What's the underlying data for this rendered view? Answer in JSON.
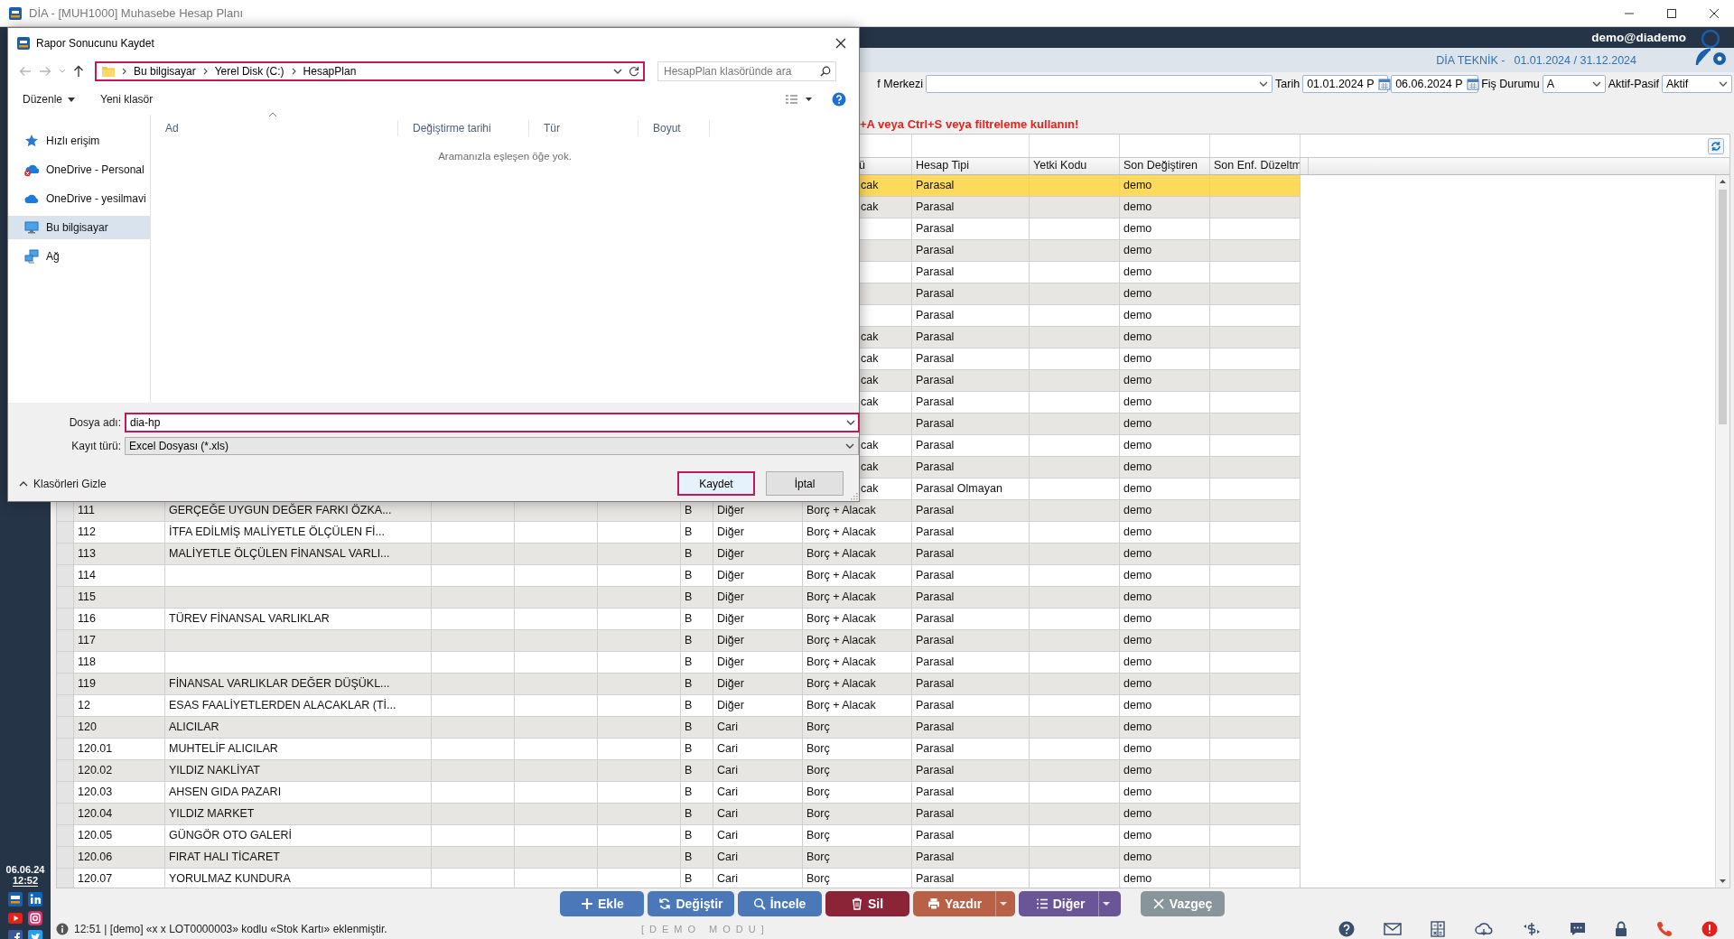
{
  "window": {
    "title": "DİA - [MUH1000] Muhasebe Hesap Planı"
  },
  "sidebar": {
    "date": "06.06.24",
    "time": "12:52"
  },
  "header": {
    "user": "demo@diademo",
    "company": "DİA TEKNİK -",
    "period": "01.01.2024 / 31.12.2024"
  },
  "filters": {
    "cost_center_label": "f Merkezi",
    "date_label": "Tarih",
    "date_from": "01.01.2024 P",
    "date_to": "06.06.2024 P",
    "status_label": "Fiş Durumu",
    "status": "A",
    "active_label": "Aktif-Pasif",
    "active": "Aktif"
  },
  "hint": "+A veya Ctrl+S veya filtreleme kullanın!",
  "table": {
    "columns": [
      "ü",
      "Hesap Tipi",
      "Yetki Kodu",
      "Son Değiştiren",
      "Son Enf. Düzeltm"
    ],
    "rows": [
      {
        "selected": true,
        "balance": "cak",
        "type": "Parasal",
        "modified_by": "demo"
      },
      {
        "selected": false,
        "balance": "cak",
        "type": "Parasal",
        "modified_by": "demo"
      },
      {
        "selected": false,
        "type": "Parasal",
        "modified_by": "demo"
      },
      {
        "selected": false,
        "type": "Parasal",
        "modified_by": "demo"
      },
      {
        "selected": false,
        "type": "Parasal",
        "modified_by": "demo"
      },
      {
        "selected": false,
        "type": "Parasal",
        "modified_by": "demo"
      },
      {
        "selected": false,
        "type": "Parasal",
        "modified_by": "demo"
      },
      {
        "selected": false,
        "balance": "cak",
        "type": "Parasal",
        "modified_by": "demo"
      },
      {
        "selected": false,
        "balance": "cak",
        "type": "Parasal",
        "modified_by": "demo"
      },
      {
        "selected": false,
        "balance": "cak",
        "type": "Parasal",
        "modified_by": "demo"
      },
      {
        "selected": false,
        "balance": "cak",
        "type": "Parasal",
        "modified_by": "demo"
      },
      {
        "selected": false,
        "type": "Parasal",
        "modified_by": "demo"
      },
      {
        "selected": false,
        "balance": "cak",
        "type": "Parasal",
        "modified_by": "demo"
      },
      {
        "selected": false,
        "balance": "cak",
        "type": "Parasal",
        "modified_by": "demo"
      },
      {
        "selected": false,
        "balance": "cak",
        "type": "Parasal Olmayan",
        "modified_by": "demo"
      },
      {
        "selected": false,
        "code": "111",
        "name": "GERÇEĞE UYGUN DEĞER FARKI ÖZKA...",
        "column_6": "B",
        "group": "Diğer",
        "balance": "Borç + Alacak",
        "type": "Parasal",
        "modified_by": "demo"
      },
      {
        "selected": false,
        "code": "112",
        "name": "İTFA EDİLMİŞ MALİYETLE ÖLÇÜLEN Fİ...",
        "column_6": "B",
        "group": "Diğer",
        "balance": "Borç + Alacak",
        "type": "Parasal",
        "modified_by": "demo"
      },
      {
        "selected": false,
        "code": "113",
        "name": "MALİYETLE ÖLÇÜLEN FİNANSAL VARLI...",
        "column_6": "B",
        "group": "Diğer",
        "balance": "Borç + Alacak",
        "type": "Parasal",
        "modified_by": "demo"
      },
      {
        "selected": false,
        "code": "114",
        "column_6": "B",
        "group": "Diğer",
        "balance": "Borç + Alacak",
        "type": "Parasal",
        "modified_by": "demo"
      },
      {
        "selected": false,
        "code": "115",
        "column_6": "B",
        "group": "Diğer",
        "balance": "Borç + Alacak",
        "type": "Parasal",
        "modified_by": "demo"
      },
      {
        "selected": false,
        "code": "116",
        "name": "TÜREV FİNANSAL VARLIKLAR",
        "column_6": "B",
        "group": "Diğer",
        "balance": "Borç + Alacak",
        "type": "Parasal",
        "modified_by": "demo"
      },
      {
        "selected": false,
        "code": "117",
        "column_6": "B",
        "group": "Diğer",
        "balance": "Borç + Alacak",
        "type": "Parasal",
        "modified_by": "demo"
      },
      {
        "selected": false,
        "code": "118",
        "column_6": "B",
        "group": "Diğer",
        "balance": "Borç + Alacak",
        "type": "Parasal",
        "modified_by": "demo"
      },
      {
        "selected": false,
        "code": "119",
        "name": "FİNANSAL VARLIKLAR DEĞER DÜŞÜKL...",
        "column_6": "B",
        "group": "Diğer",
        "balance": "Borç + Alacak",
        "type": "Parasal",
        "modified_by": "demo"
      },
      {
        "selected": false,
        "code": "12",
        "name": "ESAS FAALİYETLERDEN ALACAKLAR (Tİ...",
        "column_6": "B",
        "group": "Diğer",
        "balance": "Borç + Alacak",
        "type": "Parasal",
        "modified_by": "demo"
      },
      {
        "selected": false,
        "code": "120",
        "name": "ALICILAR",
        "column_6": "B",
        "group": "Cari",
        "balance": "Borç",
        "type": "Parasal",
        "modified_by": "demo"
      },
      {
        "selected": false,
        "code": "120.01",
        "name": "MUHTELİF ALICILAR",
        "column_6": "B",
        "group": "Cari",
        "balance": "Borç",
        "type": "Parasal",
        "modified_by": "demo"
      },
      {
        "selected": false,
        "code": "120.02",
        "name": "YILDIZ NAKLİYAT",
        "column_6": "B",
        "group": "Cari",
        "balance": "Borç",
        "type": "Parasal",
        "modified_by": "demo"
      },
      {
        "selected": false,
        "code": "120.03",
        "name": "AHSEN GIDA PAZARI",
        "column_6": "B",
        "group": "Cari",
        "balance": "Borç",
        "type": "Parasal",
        "modified_by": "demo"
      },
      {
        "selected": false,
        "code": "120.04",
        "name": "YILDIZ MARKET",
        "column_6": "B",
        "group": "Cari",
        "balance": "Borç",
        "type": "Parasal",
        "modified_by": "demo"
      },
      {
        "selected": false,
        "code": "120.05",
        "name": "GÜNGÖR OTO GALERİ",
        "column_6": "B",
        "group": "Cari",
        "balance": "Borç",
        "type": "Parasal",
        "modified_by": "demo"
      },
      {
        "selected": false,
        "code": "120.06",
        "name": "FIRAT HALI TİCARET",
        "column_6": "B",
        "group": "Cari",
        "balance": "Borç",
        "type": "Parasal",
        "modified_by": "demo"
      },
      {
        "selected": false,
        "code": "120.07",
        "name": "YORULMAZ KUNDURA",
        "column_6": "B",
        "group": "Cari",
        "balance": "Borç",
        "type": "Parasal",
        "modified_by": "demo"
      }
    ]
  },
  "buttons": [
    {
      "label": "Ekle",
      "kind": "add",
      "color": "#4a78b9",
      "dropdown": false
    },
    {
      "label": "Değiştir",
      "kind": "edit",
      "color": "#4a78b9",
      "dropdown": false
    },
    {
      "label": "İncele",
      "kind": "inspect",
      "color": "#4a78b9",
      "dropdown": false
    },
    {
      "label": "Sil",
      "kind": "delete",
      "color": "#8c2438",
      "dropdown": false
    },
    {
      "label": "Yazdır",
      "kind": "print",
      "color": "#b96147",
      "dropdown": true
    },
    {
      "label": "Diğer",
      "kind": "more",
      "color": "#6a5697",
      "dropdown": true
    },
    {
      "label": "Vazgeç",
      "kind": "cancel",
      "color": "#88969b",
      "dropdown": false
    }
  ],
  "status_bar": {
    "message": "12:51 | [demo] «x x LOT0000003» kodlu «Stok Kartı» eklenmiştir.",
    "mode": "[DEMO MODU]"
  },
  "dialog": {
    "title": "Rapor Sonucunu Kaydet",
    "path": [
      "Bu bilgisayar",
      "Yerel Disk (C:)",
      "HesapPlan"
    ],
    "path_highlighted": true,
    "search_placeholder": "HesapPlan klasöründe ara",
    "organize": "Düzenle",
    "new_folder": "Yeni klasör",
    "nav": [
      {
        "label": "Hızlı erişim",
        "kind": "star",
        "selected": false
      },
      {
        "label": "OneDrive - Personal",
        "kind": "offline",
        "selected": false
      },
      {
        "label": "OneDrive - yesilmavi",
        "kind": "cloud",
        "selected": false
      },
      {
        "label": "Bu bilgisayar",
        "kind": "computer",
        "selected": true
      },
      {
        "label": "Ağ",
        "kind": "network",
        "selected": false
      }
    ],
    "columns": [
      "Ad",
      "Değiştirme tarihi",
      "Tür",
      "Boyut"
    ],
    "empty_message": "Aramanızla eşleşen öğe yok.",
    "filename_label": "Dosya adı:",
    "filename": "dia-hp",
    "filename_highlighted": true,
    "filetype_label": "Kayıt türü:",
    "filetype": "Excel Dosyası (*.xls)",
    "hide_folders": "Klasörleri Gizle",
    "buttons": [
      {
        "label": "Kaydet",
        "highlighted": true
      },
      {
        "label": "İptal",
        "highlighted": false
      }
    ]
  }
}
